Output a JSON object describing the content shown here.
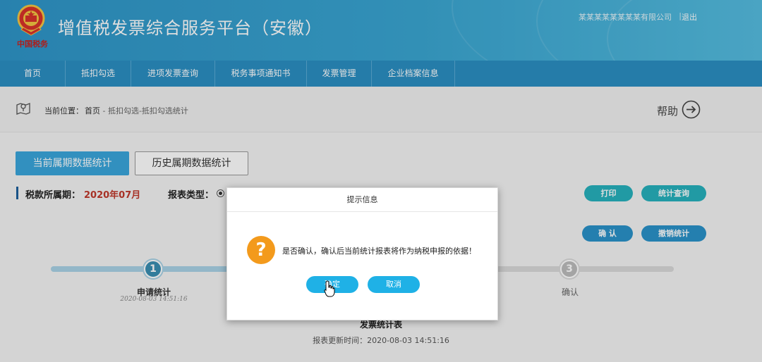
{
  "header": {
    "emblem_caption": "中国税务",
    "title": "增值税发票综合服务平台（安徽）",
    "user_info": "某某某某某某某某有限公司",
    "separator": "|",
    "logout": "退出"
  },
  "nav": {
    "items": [
      "首页",
      "抵扣勾选",
      "进项发票查询",
      "税务事项通知书",
      "发票管理",
      "企业档案信息"
    ]
  },
  "breadcrumb": {
    "label": "当前位置：",
    "home": "首页",
    "rest": " - 抵扣勾选-抵扣勾选统计",
    "help": "帮助"
  },
  "tabs": {
    "current": "当前属期数据统计",
    "history": "历史属期数据统计"
  },
  "filters": {
    "period_label": "税款所属期：",
    "period_value": "2020年07月",
    "report_type_label": "报表类型："
  },
  "actions": {
    "print": "打印",
    "stat_query": "统计查询",
    "confirm": "确 认",
    "cancel_stat": "撤销统计"
  },
  "steps": [
    {
      "number": "1",
      "label": "申请统计",
      "time": "2020-08-03 14:51:16"
    },
    {
      "number": "3",
      "label": "确认",
      "time": ""
    }
  ],
  "report": {
    "title": "发票统计表",
    "update_time": "报表更新时间：2020-08-03 14:51:16"
  },
  "modal": {
    "title": "提示信息",
    "message": "是否确认，确认后当前统计报表将作为纳税申报的依据！",
    "ok": "确定",
    "cancel": "取消"
  },
  "colors": {
    "header": "#3aa6d2",
    "nav": "#2b8fc3",
    "accent_blue": "#3aa6dc",
    "teal": "#27b1bd",
    "period_red": "#c0392b",
    "question_orange": "#f39a1c",
    "modal_button": "#1fb1e6"
  },
  "icons": [
    "national-emblem-icon",
    "map-location-icon",
    "arrow-right-circle-icon",
    "question-icon",
    "hand-cursor-icon"
  ]
}
